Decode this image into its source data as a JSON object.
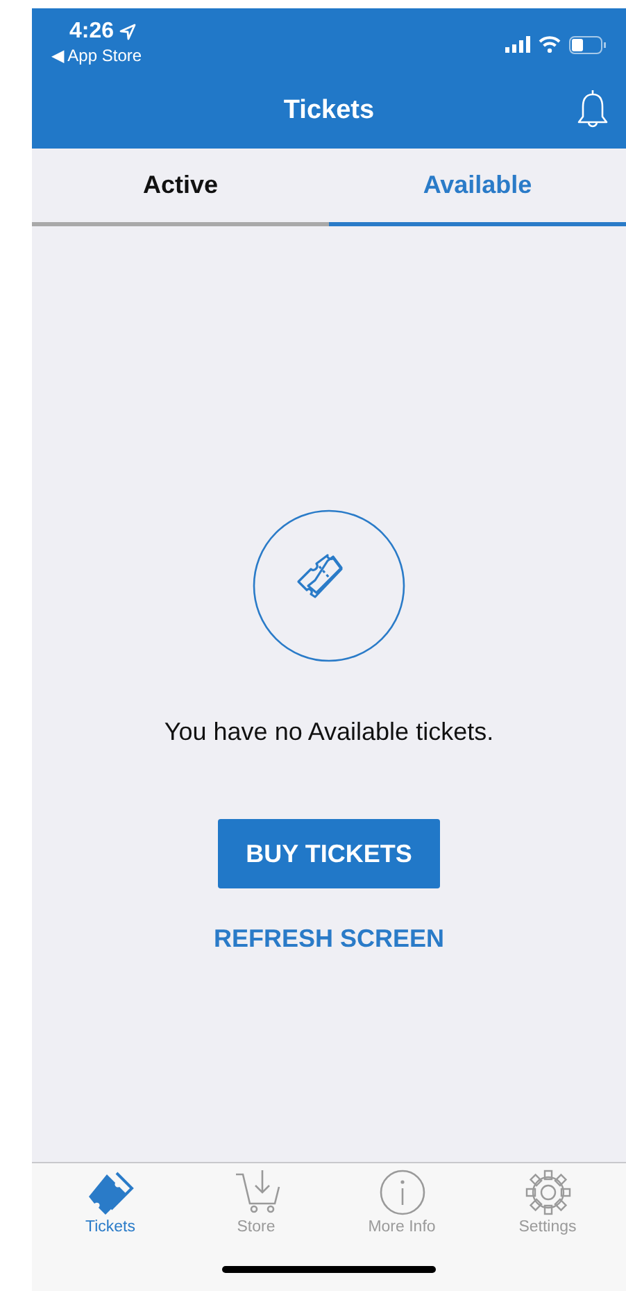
{
  "status_bar": {
    "time": "4:26",
    "back_label": "◀ App Store"
  },
  "header": {
    "title": "Tickets"
  },
  "tabs": [
    {
      "label": "Active",
      "selected": false
    },
    {
      "label": "Available",
      "selected": true
    }
  ],
  "empty_state": {
    "message": "You have no Available tickets.",
    "primary_button": "BUY TICKETS",
    "link": "REFRESH SCREEN"
  },
  "tab_bar": [
    {
      "label": "Tickets",
      "selected": true
    },
    {
      "label": "Store",
      "selected": false
    },
    {
      "label": "More Info",
      "selected": false
    },
    {
      "label": "Settings",
      "selected": false
    }
  ]
}
